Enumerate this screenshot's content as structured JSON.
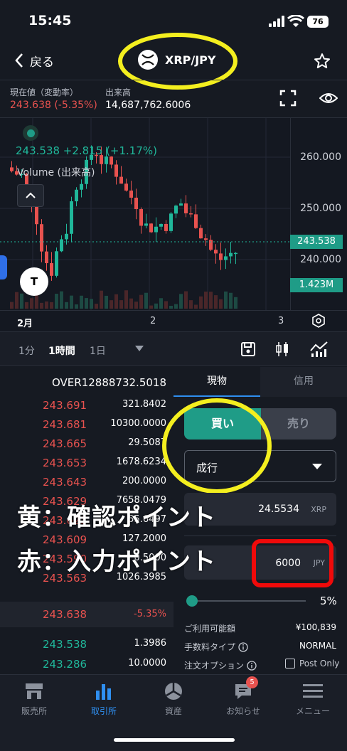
{
  "status_bar": {
    "time": "15:45",
    "battery": "76"
  },
  "header": {
    "back_label": "戻る",
    "pair": "XRP/JPY"
  },
  "info": {
    "current_label": "現在値（変動率）",
    "current_value": "243.638 (-5.35%)",
    "volume_label": "出来高",
    "volume_value": "14,687,762.6006"
  },
  "chart": {
    "price_change": "243.538 +2.815 (+1.17%)",
    "volume_label": "Volume (出来高)",
    "y_labels": [
      "260.000",
      "250.000",
      "240.000"
    ],
    "last_price_tag": "243.538",
    "volume_tag": "1.423M",
    "x_labels": [
      "2月",
      "2",
      "3"
    ]
  },
  "timeframes": {
    "items": [
      "1分",
      "1時間",
      "1日"
    ],
    "active": "1時間"
  },
  "orderbook": {
    "header": "OVER12888732.5018",
    "asks": [
      {
        "price": "243.691",
        "qty": "321.8402"
      },
      {
        "price": "243.681",
        "qty": "10300.0000"
      },
      {
        "price": "243.665",
        "qty": "29.5087"
      },
      {
        "price": "243.653",
        "qty": "1678.6234"
      },
      {
        "price": "243.643",
        "qty": "200.0000"
      },
      {
        "price": "243.629",
        "qty": "7658.0479"
      },
      {
        "price": "243.621",
        "qty": "55.6497"
      },
      {
        "price": "243.609",
        "qty": "127.2000"
      },
      {
        "price": "243.590",
        "qty": "0.5000"
      },
      {
        "price": "243.563",
        "qty": "1026.3985"
      }
    ],
    "mid_price": "243.638",
    "mid_change": "-5.35%",
    "bids": [
      {
        "price": "243.538",
        "qty": "1.3986"
      },
      {
        "price": "243.286",
        "qty": "10.0000"
      }
    ]
  },
  "order_panel": {
    "tab_spot": "現物",
    "tab_margin": "信用",
    "buy_label": "買い",
    "sell_label": "売り",
    "order_type": "成行",
    "qty_value": "24.5534",
    "qty_unit": "XRP",
    "amount_value": "6000",
    "amount_unit": "JPY",
    "slider_percent": "5%",
    "available_label": "ご利用可能額",
    "available_value": "¥100,839",
    "fee_label": "手数料タイプ",
    "fee_value": "NORMAL",
    "order_option_label": "注文オプション",
    "post_only_label": "Post Only"
  },
  "annotations": {
    "yellow_note": "黄：確認ポイント",
    "red_note": "赤：入力ポイント"
  },
  "bottom_nav": {
    "items": [
      "販売所",
      "取引所",
      "資産",
      "お知らせ",
      "メニュー"
    ],
    "active": "取引所",
    "badge": "5"
  },
  "colors": {
    "up": "#20b79a",
    "down": "#e8524f",
    "accent": "#1f9c87",
    "highlight_yellow": "#f4ef1f",
    "highlight_red": "#f00a0a"
  }
}
